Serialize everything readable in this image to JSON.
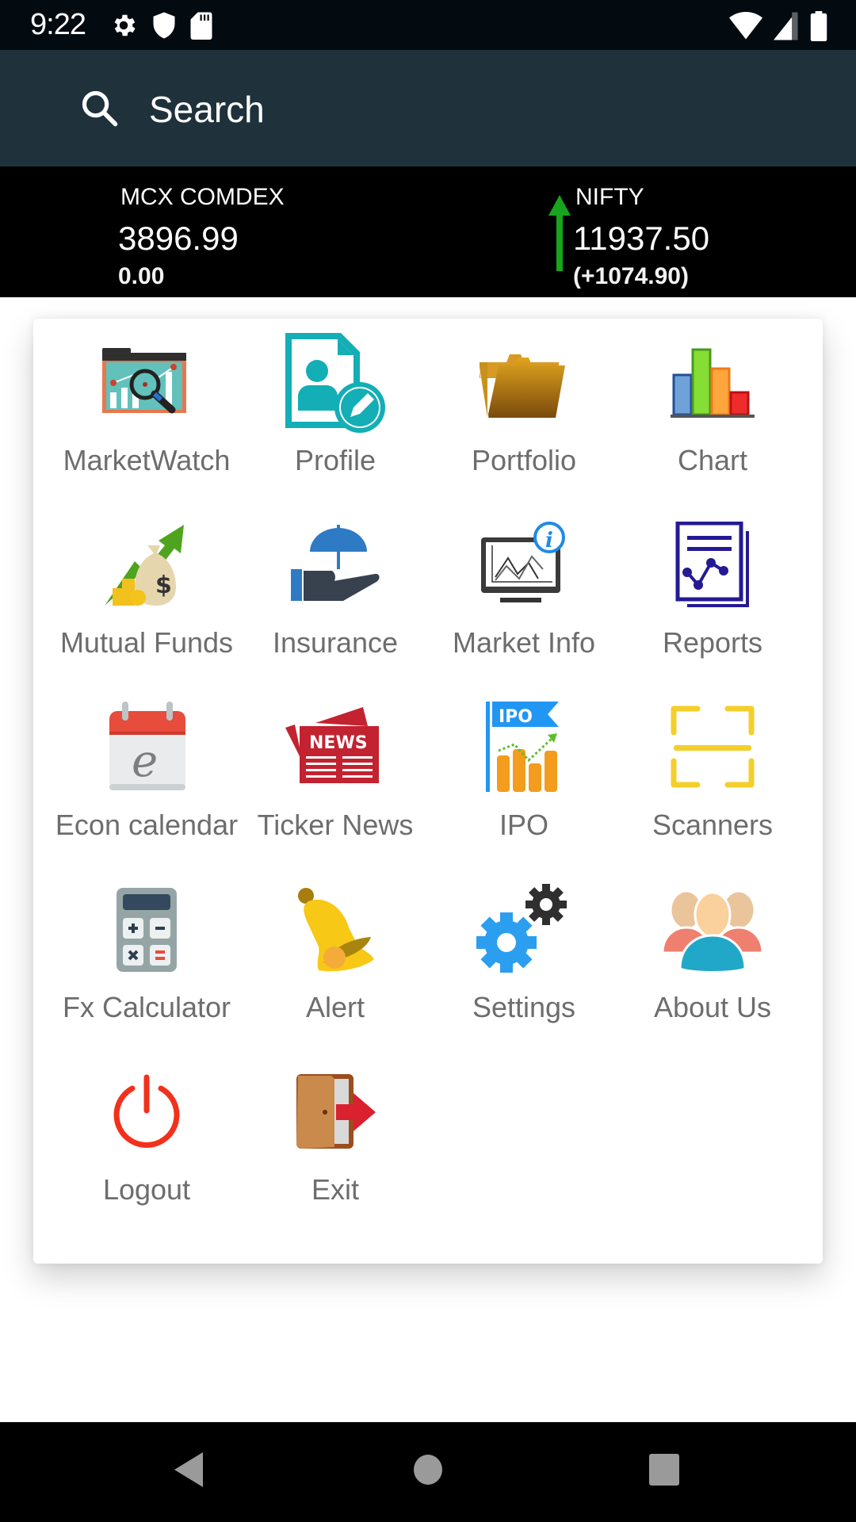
{
  "status_bar": {
    "time": "9:22",
    "left_icons": [
      "gear-icon",
      "shield-icon",
      "sd-card-icon"
    ],
    "right_icons": [
      "wifi-icon",
      "cellular-signal-icon",
      "battery-icon"
    ]
  },
  "app_bar": {
    "search_label": "Search",
    "search_icon": "search-icon"
  },
  "ticker": [
    {
      "name": "MCX COMDEX",
      "value": "3896.99",
      "change": "0.00",
      "direction": "none"
    },
    {
      "name": "NIFTY",
      "value": "11937.50",
      "change": "(+1074.90)",
      "direction": "up",
      "direction_color": "#18a41c"
    }
  ],
  "menu": {
    "items": [
      {
        "label": "MarketWatch",
        "icon": "market-watch-icon"
      },
      {
        "label": "Profile",
        "icon": "profile-icon"
      },
      {
        "label": "Portfolio",
        "icon": "portfolio-folder-icon"
      },
      {
        "label": "Chart",
        "icon": "bar-chart-icon"
      },
      {
        "label": "Mutual Funds",
        "icon": "money-bag-growth-icon"
      },
      {
        "label": "Insurance",
        "icon": "umbrella-hand-icon"
      },
      {
        "label": "Market Info",
        "icon": "monitor-info-icon"
      },
      {
        "label": "Reports",
        "icon": "report-document-icon"
      },
      {
        "label": "Econ calendar",
        "icon": "calendar-icon"
      },
      {
        "label": "Ticker News",
        "icon": "newspaper-icon"
      },
      {
        "label": "IPO",
        "icon": "ipo-flag-icon"
      },
      {
        "label": "Scanners",
        "icon": "scanner-frame-icon"
      },
      {
        "label": "Fx Calculator",
        "icon": "calculator-icon"
      },
      {
        "label": "Alert",
        "icon": "bell-icon"
      },
      {
        "label": "Settings",
        "icon": "gears-icon"
      },
      {
        "label": "About Us",
        "icon": "people-group-icon"
      },
      {
        "label": "Logout",
        "icon": "power-icon"
      },
      {
        "label": "Exit",
        "icon": "door-exit-icon"
      }
    ]
  },
  "nav_bar": {
    "buttons": [
      "back-icon",
      "home-icon",
      "recents-icon"
    ]
  }
}
